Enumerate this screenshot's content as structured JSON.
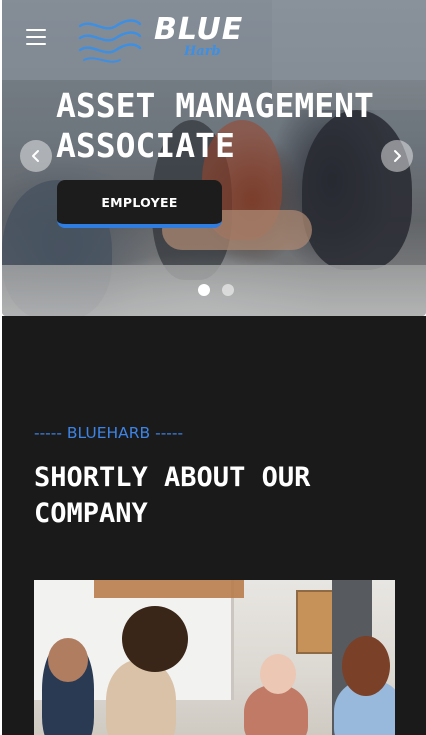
{
  "header": {
    "menu_icon": "hamburger-menu-icon",
    "logo": {
      "word": "BLUE",
      "sub": "Harb",
      "wave_color": "#3d8fe3",
      "word_color": "#ffffff"
    }
  },
  "hero": {
    "title": "ASSET MANAGEMENT ASSOCIATE",
    "button_label": "EMPLOYEE",
    "prev_icon": "chevron-left-icon",
    "next_icon": "chevron-right-icon",
    "slides_total": 2,
    "slide_active": 1,
    "accent_color": "#2f7de1"
  },
  "about": {
    "kicker": "----- BLUEHARB -----",
    "title": "SHORTLY ABOUT OUR COMPANY",
    "image": "team-meeting-photo",
    "background_color": "#1a1a1a",
    "kicker_color": "#3d84e6"
  }
}
